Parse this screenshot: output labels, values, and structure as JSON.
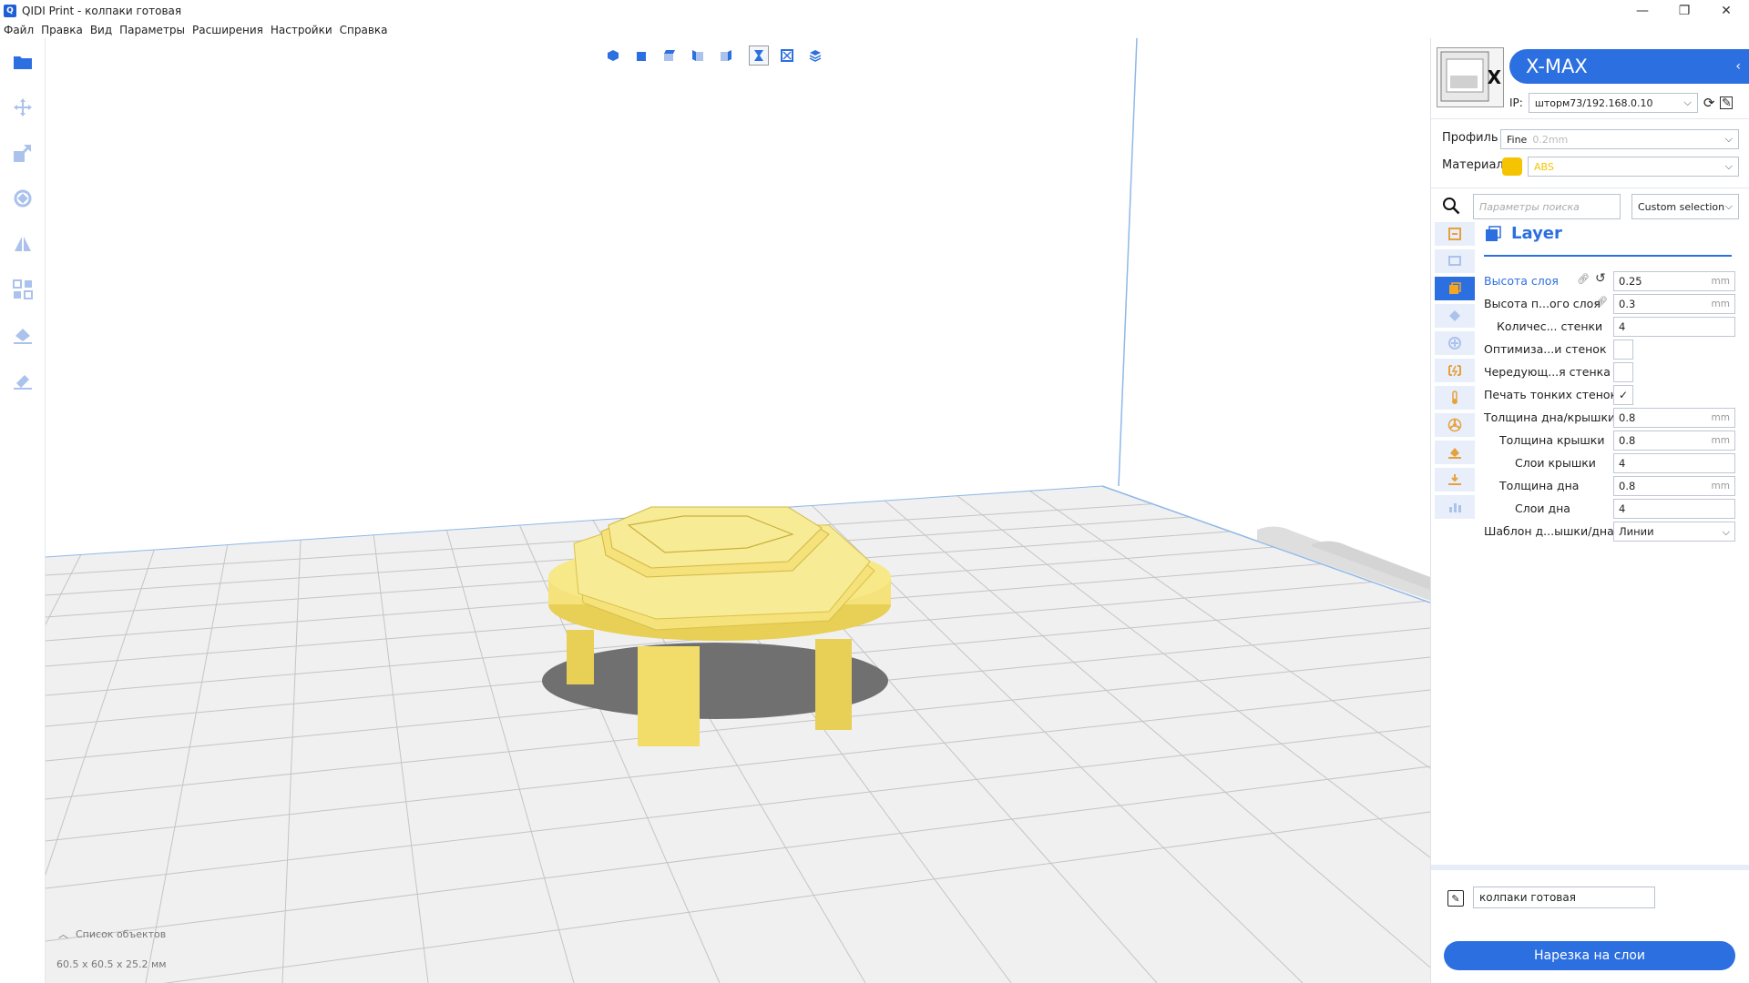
{
  "window": {
    "title": "QIDI Print - колпаки готовая",
    "app_icon": "Q",
    "minimize": "—",
    "maximize": "❐",
    "close": "✕"
  },
  "menu": [
    "Файл",
    "Правка",
    "Вид",
    "Параметры",
    "Расширения",
    "Настройки",
    "Справка"
  ],
  "sidebar_icons": [
    "folder-icon",
    "move-icon",
    "scale-icon",
    "rotate-icon",
    "mirror-icon",
    "arrange-icon",
    "support-icon",
    "support-eraser-icon"
  ],
  "view_tools": [
    "view-3d-icon",
    "view-front-icon",
    "view-top-icon",
    "view-left-icon",
    "view-right-icon",
    "x-ray-icon",
    "wireframe-icon",
    "layer-view-icon"
  ],
  "viewport": {
    "object_list": "Список объектов",
    "dimensions": "60.5 x 60.5 x 25.2 мм",
    "colors": {
      "model": "#f5e27a",
      "shadow": "#6f6f6f",
      "grid": "#c9c9c9",
      "bed": "#f2f2f2"
    }
  },
  "printer": {
    "name": "X-MAX",
    "ip_label": "IP:",
    "ip_value": "штopм73/192.168.0.10",
    "badge": "X"
  },
  "profile": {
    "label": "Профиль",
    "value": "Fine",
    "hint": "0.2mm"
  },
  "material": {
    "label": "Материал",
    "value": "ABS",
    "color": "#f5c400"
  },
  "search": {
    "placeholder": "Параметры поиска",
    "selection": "Custom selection"
  },
  "section": {
    "title": "Layer"
  },
  "params": [
    {
      "label": "Высота слоя",
      "value": "0.25",
      "unit": "mm",
      "type": "field",
      "highlight": true,
      "indent": 0
    },
    {
      "label": "Высота п...ого слоя",
      "value": "0.3",
      "unit": "mm",
      "type": "field",
      "indent": 0
    },
    {
      "label": "Количес... стенки",
      "value": "4",
      "unit": "",
      "type": "field",
      "indent": 14
    },
    {
      "label": "Оптимиза...и стенок",
      "value": "",
      "unit": "",
      "type": "check",
      "indent": 0
    },
    {
      "label": "Чередующ...я стенка",
      "value": "",
      "unit": "",
      "type": "check",
      "indent": 0
    },
    {
      "label": "Печать тонких стенок",
      "value": "✓",
      "unit": "",
      "type": "check",
      "indent": 0
    },
    {
      "label": "Толщина дна/крышки",
      "value": "0.8",
      "unit": "mm",
      "type": "field",
      "indent": 0
    },
    {
      "label": "Толщина крышки",
      "value": "0.8",
      "unit": "mm",
      "type": "field",
      "indent": 17
    },
    {
      "label": "Слои крышки",
      "value": "4",
      "unit": "",
      "type": "field",
      "indent": 34
    },
    {
      "label": "Толщина дна",
      "value": "0.8",
      "unit": "mm",
      "type": "field",
      "indent": 17
    },
    {
      "label": "Слои дна",
      "value": "4",
      "unit": "",
      "type": "field",
      "indent": 34
    },
    {
      "label": "Шаблон д...ышки/дна",
      "value": "Линии",
      "unit": "",
      "type": "select",
      "indent": 0
    }
  ],
  "job": {
    "name": "колпаки готовая"
  },
  "slice_button": "Нарезка на слои"
}
